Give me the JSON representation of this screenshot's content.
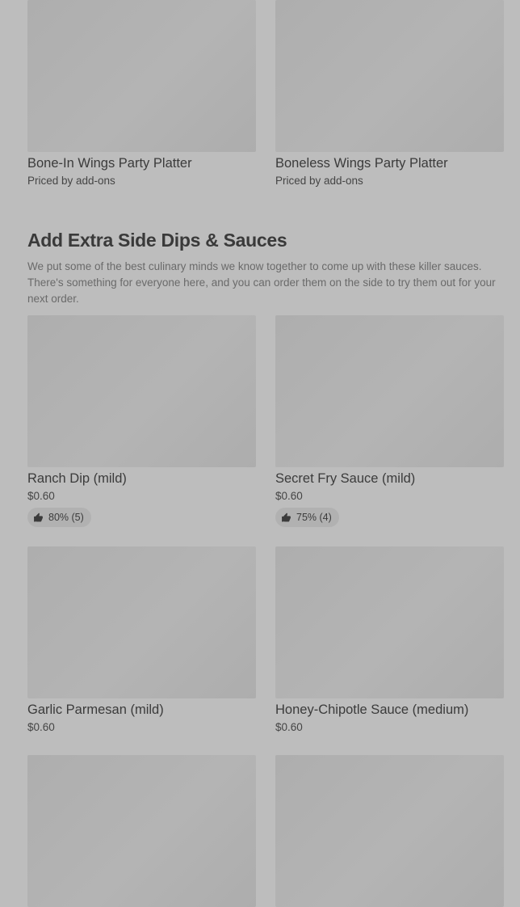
{
  "top_items": [
    {
      "name": "Bone-In Wings Party Platter",
      "price": "Priced by add-ons"
    },
    {
      "name": "Boneless Wings Party Platter",
      "price": "Priced by add-ons"
    }
  ],
  "section": {
    "title": "Add Extra Side Dips & Sauces",
    "description": "We put some of the best culinary minds we know together to come up with these killer sauces. There's something for everyone here, and you can order them on the side to try them out for your next order."
  },
  "sauces_row1": [
    {
      "name": "Ranch Dip (mild)",
      "price": "$0.60",
      "rating": "80% (5)"
    },
    {
      "name": "Secret Fry Sauce (mild)",
      "price": "$0.60",
      "rating": "75% (4)"
    }
  ],
  "sauces_row2": [
    {
      "name": "Garlic Parmesan (mild)",
      "price": "$0.60"
    },
    {
      "name": "Honey-Chipotle Sauce (medium)",
      "price": "$0.60"
    }
  ],
  "icons": {
    "rating": "thumbs-up-icon"
  }
}
